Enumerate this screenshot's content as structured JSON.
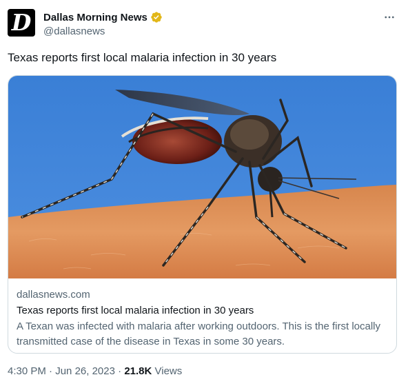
{
  "account": {
    "display_name": "Dallas Morning News",
    "handle": "@dallasnews",
    "avatar_letter": "D",
    "verified": true,
    "verified_badge_color": "#e2b719"
  },
  "tweet": {
    "text": "Texas reports first local malaria infection in 30 years"
  },
  "card": {
    "image": "mosquito-on-skin-photo",
    "domain": "dallasnews.com",
    "title": "Texas reports first local malaria infection in 30 years",
    "description": "A Texan was infected with malaria after working outdoors. This is the first locally transmitted case of the disease in Texas in some 30 years."
  },
  "meta": {
    "time": "4:30 PM",
    "separator": "·",
    "date": "Jun 26, 2023",
    "views_count": "21.8K",
    "views_label": "Views"
  },
  "icons": {
    "more": "more-options-icon",
    "verified": "verified-badge-icon"
  },
  "colors": {
    "text_primary": "#0f1419",
    "text_secondary": "#536471",
    "card_border": "#cfd9de",
    "sky": "#3f86d8",
    "skin": "#e08a52"
  }
}
